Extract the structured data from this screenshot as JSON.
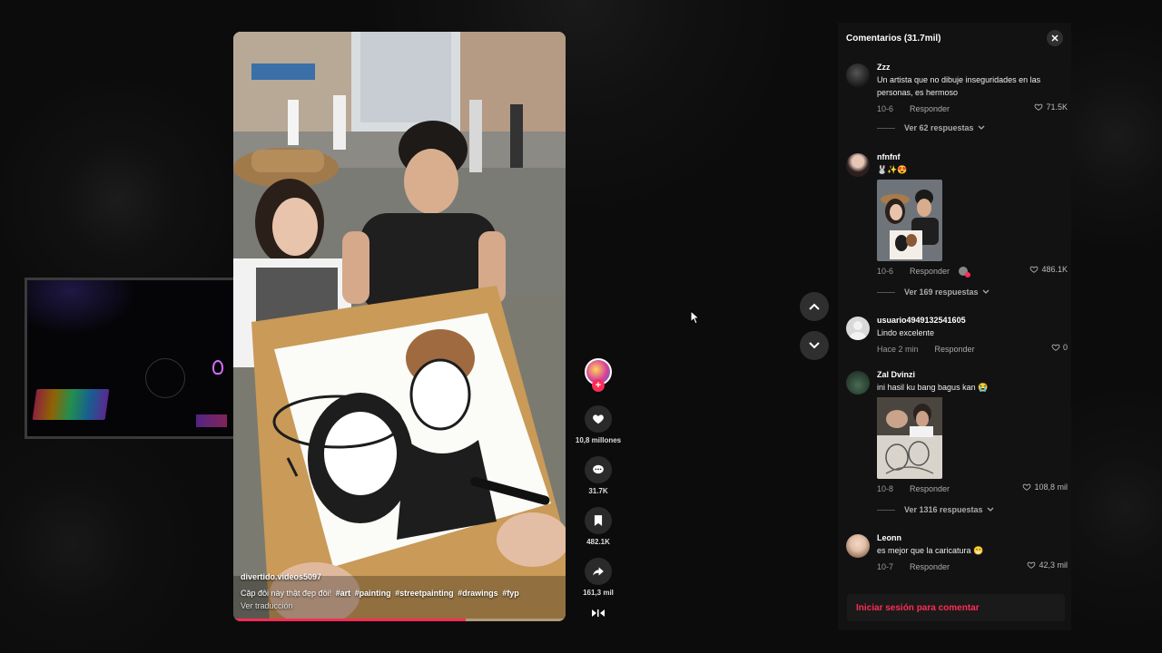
{
  "video": {
    "author": "divertido.videos5097",
    "caption": "Cặp đôi này thật đẹp đôi!",
    "hashtags": [
      "#art",
      "#painting",
      "#streetpainting",
      "#drawings",
      "#fyp"
    ],
    "translate_label": "Ver traducción",
    "progress": 0.7
  },
  "actions": {
    "likes": "10,8 millones",
    "comments": "31.7K",
    "saves": "482.1K",
    "shares": "161,3 mil",
    "follow_symbol": "+"
  },
  "panel": {
    "title": "Comentarios (31.7mil)",
    "login_label": "Iniciar sesión para comentar"
  },
  "comments": [
    {
      "user": "Zzz",
      "text": "Un artista que no dibuje inseguridades en las personas, es hermoso",
      "date": "10-6",
      "reply": "Responder",
      "likes": "71.5K",
      "replies": "Ver 62 respuestas"
    },
    {
      "user": "nfnfnf",
      "text": "🐰✨😍",
      "date": "10-6",
      "reply": "Responder",
      "likes": "486.1K",
      "replies": "Ver 169 respuestas"
    },
    {
      "user": "usuario4949132541605",
      "text": "Lindo excelente",
      "date": "Hace 2 min",
      "reply": "Responder",
      "likes": "0"
    },
    {
      "user": "Zal Dvinzi",
      "text": "ini hasil ku bang bagus kan 😭",
      "date": "10-8",
      "reply": "Responder",
      "likes": "108,8 mil",
      "replies": "Ver 1316 respuestas"
    },
    {
      "user": "Leonn",
      "text": "es mejor que la caricatura 😁",
      "date": "10-7",
      "reply": "Responder",
      "likes": "42,3 mil"
    }
  ]
}
